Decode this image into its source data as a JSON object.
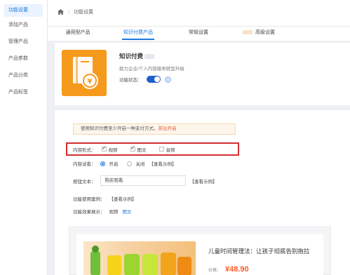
{
  "sidebar": {
    "items": [
      {
        "label": "功能设置"
      },
      {
        "label": "添加产品"
      },
      {
        "label": "管理产品"
      },
      {
        "label": "产品参数"
      },
      {
        "label": "产品分类"
      },
      {
        "label": "产品标签"
      }
    ]
  },
  "breadcrumb": {
    "separator": "/",
    "current": "功能设置"
  },
  "tabs": [
    {
      "label": "通用型产品"
    },
    {
      "label": "知识付费产品"
    },
    {
      "label": "常规设置"
    },
    {
      "label": "高级设置"
    }
  ],
  "product": {
    "title": "知识付费",
    "subtitle": "助力企业/个人内容服务转型升级",
    "status_label": "功能状态：",
    "status_on": true
  },
  "notice": {
    "text": "使用知识付费至少开启一种支付方式，",
    "link": "前往开启"
  },
  "content_form": {
    "label": "内容形式：",
    "options": [
      {
        "label": "视频",
        "checked": true
      },
      {
        "label": "图文",
        "checked": true
      },
      {
        "label": "音频",
        "checked": false
      }
    ]
  },
  "trial": {
    "label": "内容试看：",
    "on_label": "开启",
    "off_label": "关闭",
    "example_link": "【查看示例】"
  },
  "button_text": {
    "label": "按钮文本：",
    "value": "购买观看",
    "example_link": "【查看示例】"
  },
  "usage_case": {
    "label": "功能使用案例：",
    "example_link": "【查看示例】"
  },
  "effect_display": {
    "label": "功能效果展示：",
    "video": "视频",
    "graphic": "图文"
  },
  "preview": {
    "title": "儿童时间管理法：让孩子彻底告别拖拉",
    "price_label": "价格：",
    "price": "¥48.90"
  },
  "colors": {
    "accent": "#1f7ae0",
    "price": "#ff5a28",
    "highlight_border": "#d32f2f",
    "icon_bg": "#f59a1c"
  }
}
